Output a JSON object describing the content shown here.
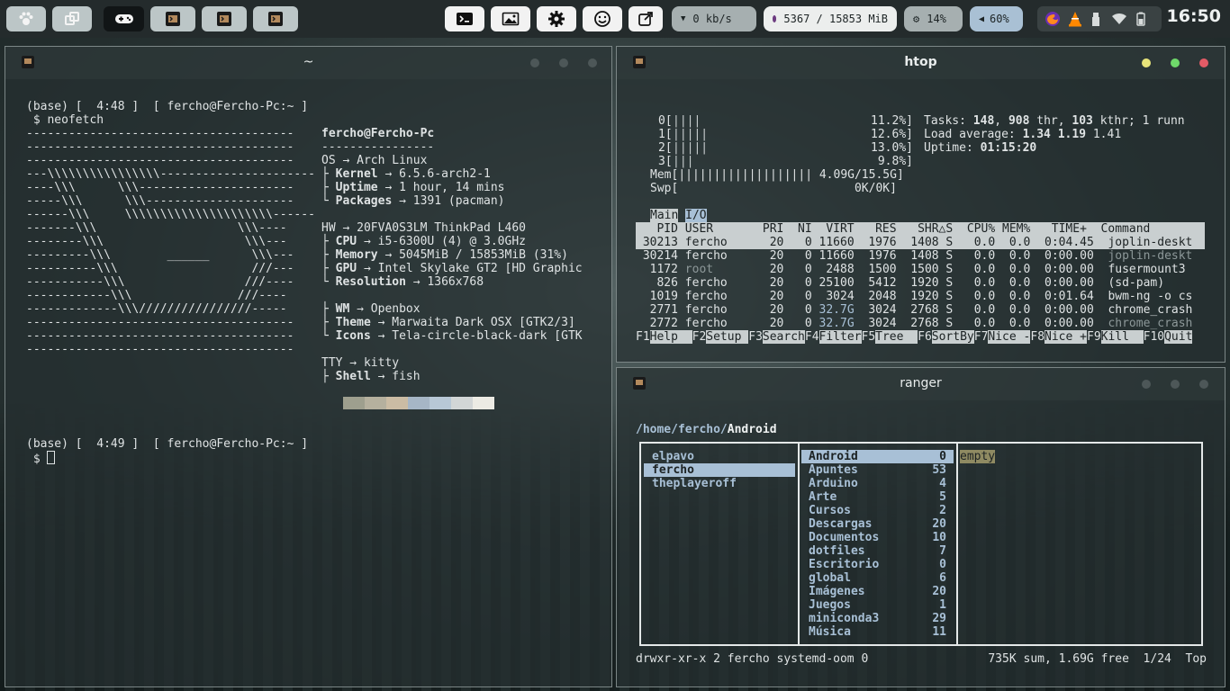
{
  "topbar": {
    "workspace_icons": [
      "paw-icon",
      "windows-icon",
      "gamepad-icon",
      "terminal-icon",
      "terminal-icon",
      "terminal-icon"
    ],
    "launcher_icons": [
      "terminal-icon",
      "image-icon",
      "gear-icon",
      "smiley-icon",
      "external-link-icon"
    ],
    "net_label": "0 kb/s",
    "mem_label": "5367 / 15853 MiB",
    "cpu_label": "14%",
    "vol_label": "60%",
    "tray_icons": [
      "firefox-icon",
      "vlc-icon",
      "usb-icon",
      "wifi-icon",
      "battery-icon"
    ],
    "clock": "16:50",
    "colors": {
      "bar": "#242b2c",
      "mem_dot": "#6d3b80"
    }
  },
  "neofetch_window": {
    "title": "~",
    "prompt1": "(base) [  4:48 ]  [ fercho@Fercho-Pc:~ ]",
    "command": " $ neofetch",
    "art": [
      "--------------------------------------",
      "--------------------------------------",
      "--------------------------------------",
      "---\\\\\\\\\\\\\\\\\\\\\\\\\\\\\\\\----------------------",
      "----\\\\\\      \\\\\\----------------------",
      "-----\\\\\\      \\\\\\---------------------",
      "------\\\\\\     \\\\\\\\\\\\\\\\\\\\\\\\\\\\\\\\\\\\\\\\\\------",
      "-------\\\\\\                    \\\\\\----",
      "--------\\\\\\                    \\\\\\---",
      "---------\\\\\\        ______      \\\\\\---",
      "----------\\\\\\                   ///---",
      "-----------\\\\\\                 ///----",
      "------------\\\\\\               ///----",
      "-------------\\\\\\////////////////-----",
      "--------------------------------------",
      "--------------------------------------",
      "--------------------------------------"
    ],
    "user_host": "fercho@Fercho-Pc",
    "separator": "----------------",
    "os_key": "OS",
    "os_val": "Arch Linux",
    "kernel_key": "Kernel",
    "kernel_val": "6.5.6-arch2-1",
    "uptime_key": "Uptime",
    "uptime_val": "1 hour, 14 mins",
    "packages_key": "Packages",
    "packages_val": "1391 (pacman)",
    "hw_key": "HW",
    "hw_val": "20FVA0S3LM ThinkPad L460",
    "cpu_key": "CPU",
    "cpu_val": "i5-6300U (4) @ 3.0GHz",
    "memory_key": "Memory",
    "memory_val": "5045MiB / 15853MiB (31%)",
    "gpu_key": "GPU",
    "gpu_val": "Intel Skylake GT2 [HD Graphic",
    "res_key": "Resolution",
    "res_val": "1366x768",
    "wm_key": "WM",
    "wm_val": "Openbox",
    "theme_key": "Theme",
    "theme_val": "Marwaita Dark OSX [GTK2/3]",
    "icons_key": "Icons",
    "icons_val": "Tela-circle-black-dark [GTK",
    "tty_key": "TTY",
    "tty_val": "kitty",
    "shell_key": "Shell",
    "shell_val": "fish",
    "palette": [
      "#9e9f8e",
      "#b5b09e",
      "#cbbca4",
      "#a6b6c6",
      "#b8c8d6",
      "#d2d6d6",
      "#ecebe4"
    ],
    "prompt2": "(base) [  4:49 ]  [ fercho@Fercho-Pc:~ ]",
    "prompt2_cmd": " $ "
  },
  "htop_window": {
    "title": "htop",
    "cpus": [
      {
        "label": "0[",
        "bar": "||||",
        "pct": "11.2%]"
      },
      {
        "label": "1[",
        "bar": "|||||",
        "pct": "12.6%]"
      },
      {
        "label": "2[",
        "bar": "|||||",
        "pct": "13.0%]"
      },
      {
        "label": "3[",
        "bar": "|||",
        "pct": "9.8%]"
      }
    ],
    "mem_label": "Mem[",
    "mem_bar": "||||||||||||||||||| 4.09G/15.5G]",
    "swp_label": "Swp[",
    "swp_val": "0K/0K]",
    "tasks_label": "Tasks: ",
    "tasks_val": "148",
    "tasks_thr": "908",
    "tasks_kthr": "103",
    "tasks_rest": "; 1 runn",
    "load_label": "Load average: ",
    "load_1": "1.34",
    "load_5": "1.19",
    "load_15": "1.41",
    "uptime_label": "Uptime: ",
    "uptime_val": "01:15:20",
    "tab_main": "Main",
    "tab_io": "I/O",
    "header": "   PID USER       PRI  NI  VIRT   RES   SHR△S  CPU% MEM%   TIME+  Command   ",
    "processes": [
      {
        "pid": "30213",
        "user": "fercho",
        "pri": "20",
        "ni": "0",
        "virt": "11660",
        "res": "1976",
        "shr": "1408",
        "s": "S",
        "cpu": "0.0",
        "mem": "0.0",
        "time": "0:04.45",
        "cmd": "joplin-deskt"
      },
      {
        "pid": "30214",
        "user": "fercho",
        "pri": "20",
        "ni": "0",
        "virt": "11660",
        "res": "1976",
        "shr": "1408",
        "s": "S",
        "cpu": "0.0",
        "mem": "0.0",
        "time": "0:00.00",
        "cmd": "joplin-deskt"
      },
      {
        "pid": "1172",
        "user": "root",
        "pri": "20",
        "ni": "0",
        "virt": "2488",
        "res": "1500",
        "shr": "1500",
        "s": "S",
        "cpu": "0.0",
        "mem": "0.0",
        "time": "0:00.00",
        "cmd": "fusermount3"
      },
      {
        "pid": "826",
        "user": "fercho",
        "pri": "20",
        "ni": "0",
        "virt": "25100",
        "res": "5412",
        "shr": "1920",
        "s": "S",
        "cpu": "0.0",
        "mem": "0.0",
        "time": "0:00.00",
        "cmd": "(sd-pam)"
      },
      {
        "pid": "1019",
        "user": "fercho",
        "pri": "20",
        "ni": "0",
        "virt": "3024",
        "res": "2048",
        "shr": "1920",
        "s": "S",
        "cpu": "0.0",
        "mem": "0.0",
        "time": "0:01.64",
        "cmd": "bwm-ng -o cs"
      },
      {
        "pid": "2771",
        "user": "fercho",
        "pri": "20",
        "ni": "0",
        "virt": "32.7G",
        "res": "3024",
        "shr": "2768",
        "s": "S",
        "cpu": "0.0",
        "mem": "0.0",
        "time": "0:00.00",
        "cmd": "chrome_crash"
      },
      {
        "pid": "2772",
        "user": "fercho",
        "pri": "20",
        "ni": "0",
        "virt": "32.7G",
        "res": "3024",
        "shr": "2768",
        "s": "S",
        "cpu": "0.0",
        "mem": "0.0",
        "time": "0:00.00",
        "cmd": "chrome_crash"
      }
    ],
    "fkeys": [
      {
        "key": "F1",
        "label": "Help  "
      },
      {
        "key": "F2",
        "label": "Setup "
      },
      {
        "key": "F3",
        "label": "Search"
      },
      {
        "key": "F4",
        "label": "Filter"
      },
      {
        "key": "F5",
        "label": "Tree  "
      },
      {
        "key": "F6",
        "label": "SortBy"
      },
      {
        "key": "F7",
        "label": "Nice -"
      },
      {
        "key": "F8",
        "label": "Nice +"
      },
      {
        "key": "F9",
        "label": "Kill  "
      },
      {
        "key": "F10",
        "label": "Quit"
      }
    ]
  },
  "ranger_window": {
    "title": "ranger",
    "path_prefix": "/home/fercho/",
    "path_current": "Android",
    "parent_items": [
      "elpavo",
      "fercho",
      "theplayeroff"
    ],
    "current_items": [
      {
        "name": "Android",
        "count": "0"
      },
      {
        "name": "Apuntes",
        "count": "53"
      },
      {
        "name": "Arduino",
        "count": "4"
      },
      {
        "name": "Arte",
        "count": "5"
      },
      {
        "name": "Cursos",
        "count": "2"
      },
      {
        "name": "Descargas",
        "count": "20"
      },
      {
        "name": "Documentos",
        "count": "10"
      },
      {
        "name": "dotfiles",
        "count": "7"
      },
      {
        "name": "Escritorio",
        "count": "0"
      },
      {
        "name": "global",
        "count": "6"
      },
      {
        "name": "Imágenes",
        "count": "20"
      },
      {
        "name": "Juegos",
        "count": "1"
      },
      {
        "name": "miniconda3",
        "count": "29"
      },
      {
        "name": "Música",
        "count": "11"
      }
    ],
    "preview": "empty",
    "status_left": "drwxr-xr-x 2 fercho systemd-oom 0",
    "status_right": "735K sum, 1.69G free  1/24  Top"
  }
}
